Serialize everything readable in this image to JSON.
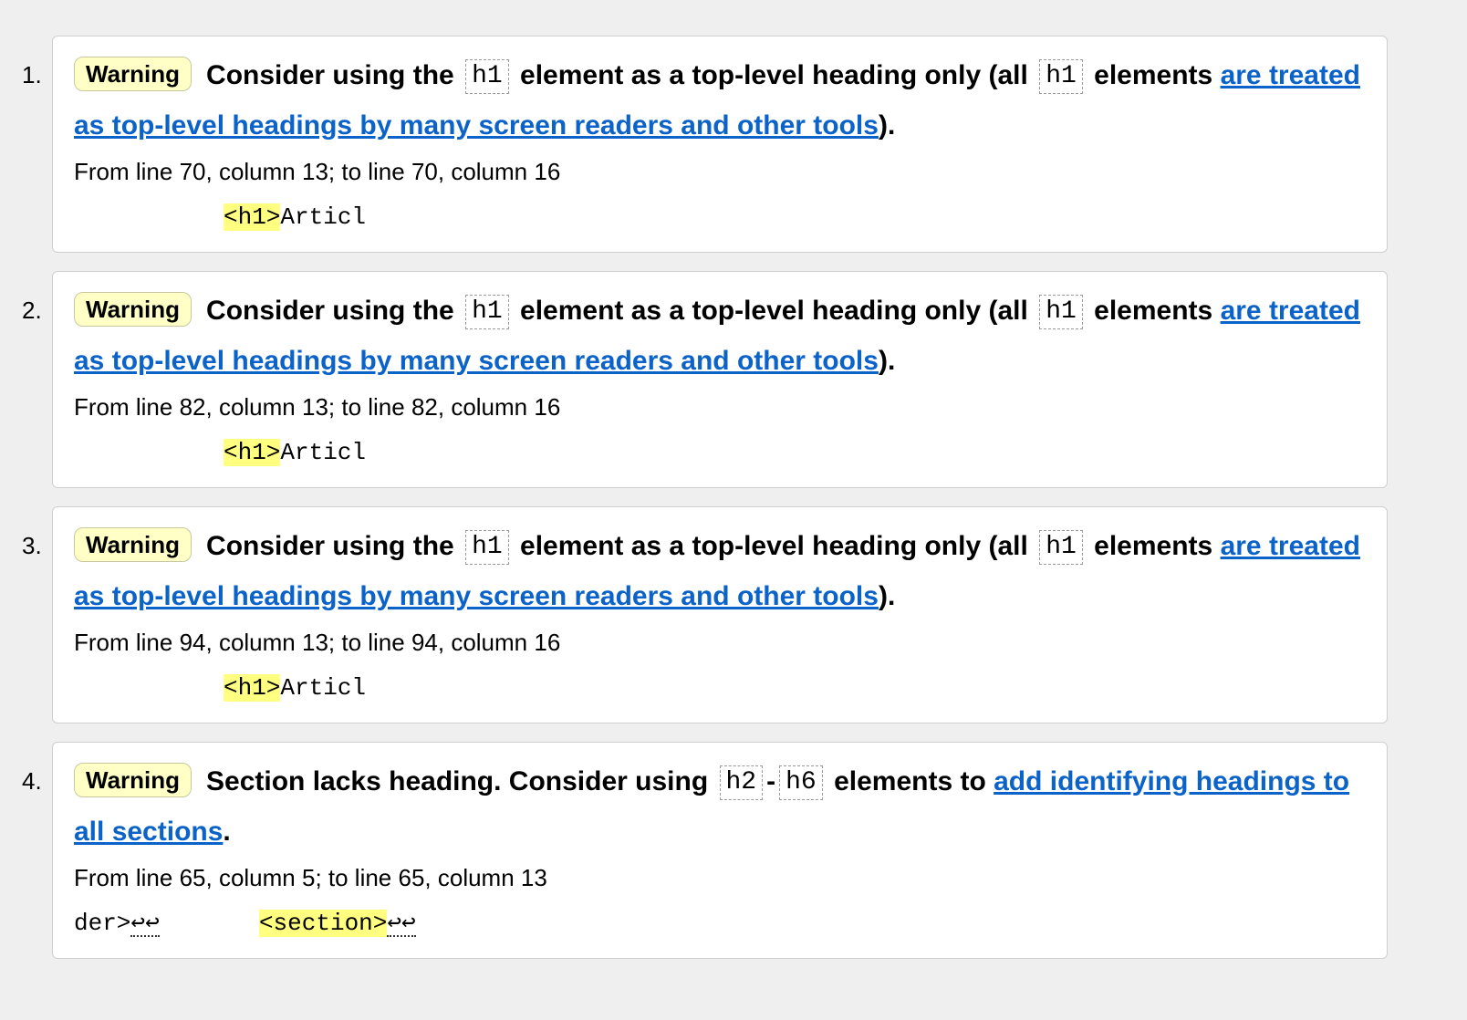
{
  "messages": [
    {
      "number": "1.",
      "badge": "Warning",
      "text_1": "Consider using the",
      "code_1": "h1",
      "text_2": "element as a top-level heading only (all",
      "code_2": "h1",
      "text_3": "elements",
      "link": "are treated as top-level headings by many screen readers and other tools",
      "text_4": ").",
      "location": "From line 70, column 13; to line 70, column 16",
      "extract_pre": "",
      "extract_pre_lf": "",
      "extract_hilite": "<h1>",
      "extract_post": "Articl",
      "extract_post_lf": ""
    },
    {
      "number": "2.",
      "badge": "Warning",
      "text_1": "Consider using the",
      "code_1": "h1",
      "text_2": "element as a top-level heading only (all",
      "code_2": "h1",
      "text_3": "elements",
      "link": "are treated as top-level headings by many screen readers and other tools",
      "text_4": ").",
      "location": "From line 82, column 13; to line 82, column 16",
      "extract_pre": "",
      "extract_pre_lf": "",
      "extract_hilite": "<h1>",
      "extract_post": "Articl",
      "extract_post_lf": ""
    },
    {
      "number": "3.",
      "badge": "Warning",
      "text_1": "Consider using the",
      "code_1": "h1",
      "text_2": "element as a top-level heading only (all",
      "code_2": "h1",
      "text_3": "elements",
      "link": "are treated as top-level headings by many screen readers and other tools",
      "text_4": ").",
      "location": "From line 94, column 13; to line 94, column 16",
      "extract_pre": "",
      "extract_pre_lf": "",
      "extract_hilite": "<h1>",
      "extract_post": "Articl",
      "extract_post_lf": ""
    },
    {
      "number": "4.",
      "badge": "Warning",
      "text_1": "Section lacks heading. Consider using",
      "code_1": "h2",
      "text_2": "-",
      "code_2": "h6",
      "text_3": "elements to",
      "link": "add identifying headings to all sections",
      "text_4": ".",
      "location": "From line 65, column 5; to line 65, column 13",
      "extract_pre": "der>",
      "extract_pre_lf": "↩↩",
      "extract_hilite": "<section>",
      "extract_post": "",
      "extract_post_lf": "↩↩"
    }
  ]
}
